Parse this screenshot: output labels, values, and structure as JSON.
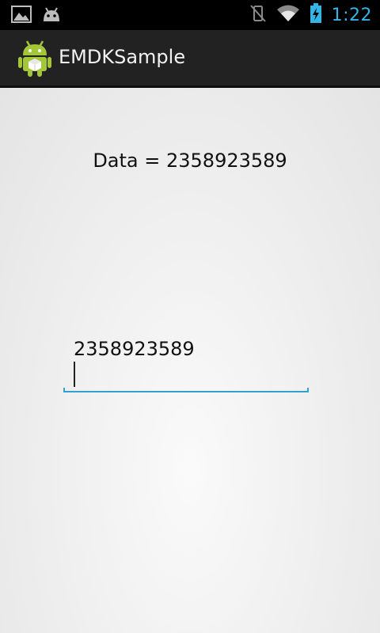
{
  "status_bar": {
    "time": "1:22",
    "left_icons": [
      "gallery-icon",
      "android-notification-icon"
    ],
    "right_icons": [
      "vibrate-off-icon",
      "wifi-icon",
      "battery-charging-icon"
    ],
    "accent_color": "#33b5e5"
  },
  "action_bar": {
    "title": "EMDKSample",
    "icon": "android-app-icon"
  },
  "main": {
    "data_label": "Data = 2358923589",
    "edit_text": {
      "value": "2358923589",
      "underline_color": "#33a0d0"
    }
  }
}
